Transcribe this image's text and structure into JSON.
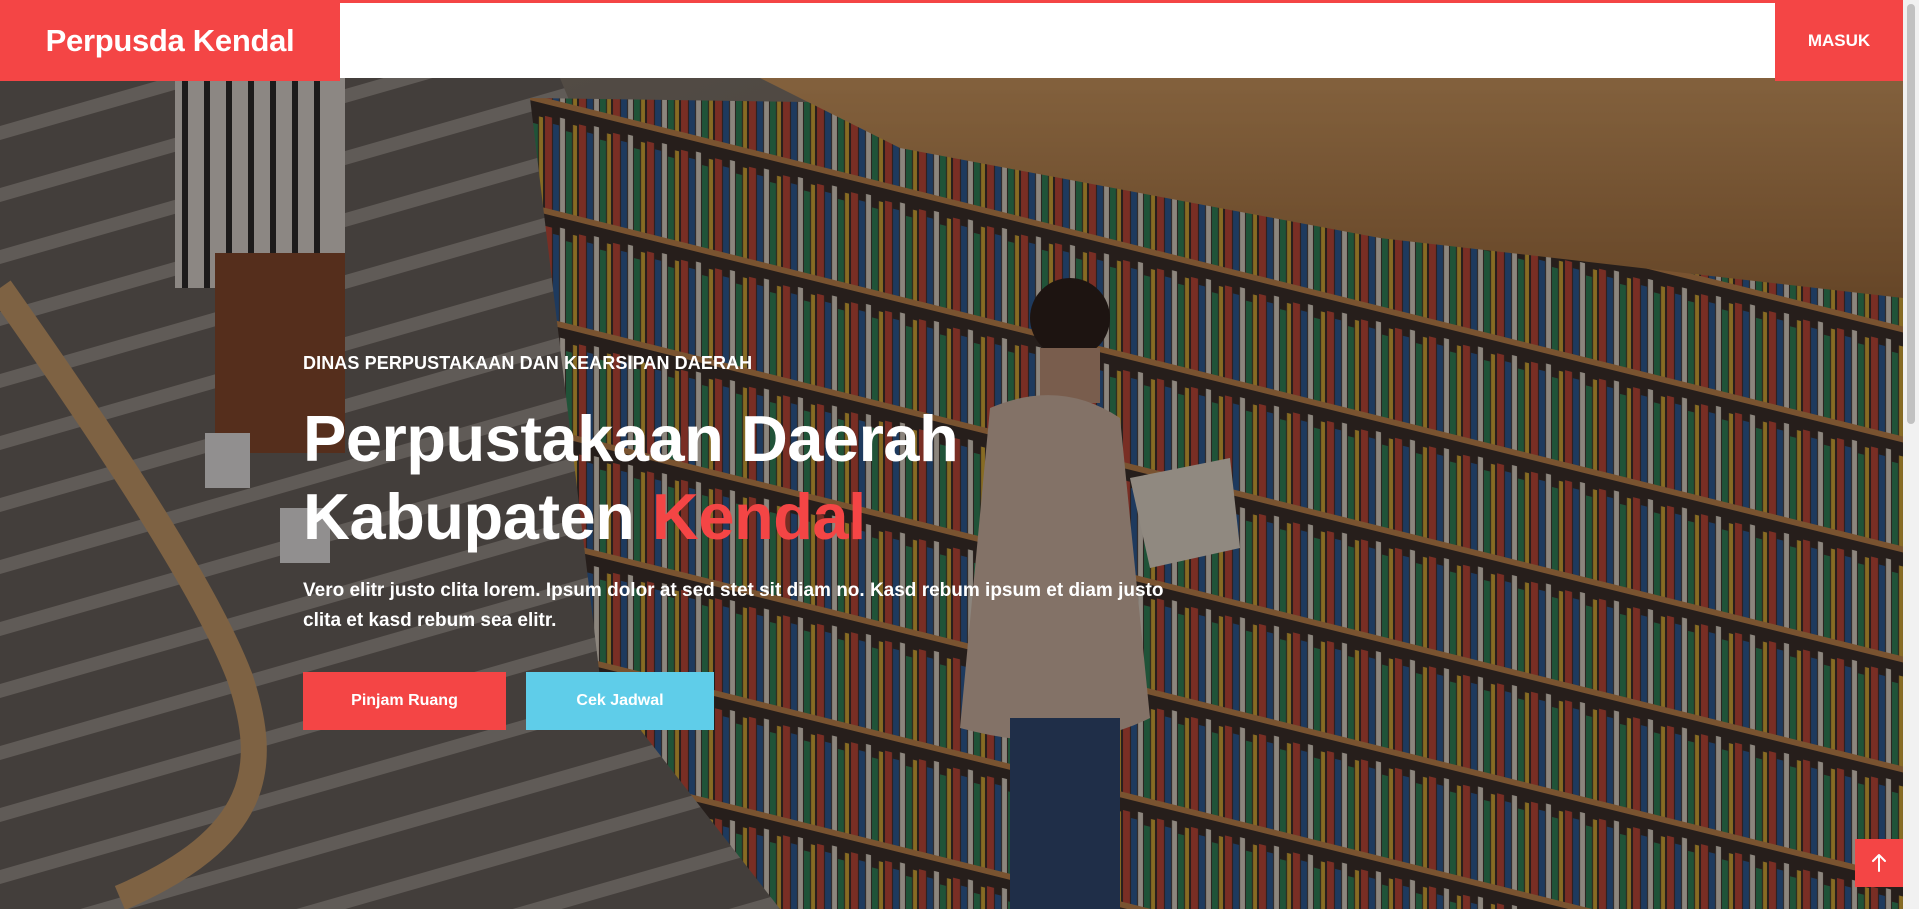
{
  "navbar": {
    "brand": "Perpusda Kendal",
    "login_label": "MASUK"
  },
  "hero": {
    "eyebrow": "DINAS PERPUSTAKAAN DAN KEARSIPAN DAERAH",
    "title_line1": "Perpustakaan Daerah",
    "title_line2_prefix": "Kabupaten ",
    "title_line2_accent": "Kendal",
    "description": "Vero elitr justo clita lorem. Ipsum dolor at sed stet sit diam no. Kasd rebum ipsum et diam justo clita et kasd rebum sea elitr.",
    "buttons": {
      "primary": "Pinjam Ruang",
      "secondary": "Cek Jadwal"
    },
    "background_icon": "library-bookshelves-photo"
  },
  "back_to_top_icon": "arrow-up-icon",
  "colors": {
    "primary": "#f44545",
    "info": "#5fcde9"
  }
}
